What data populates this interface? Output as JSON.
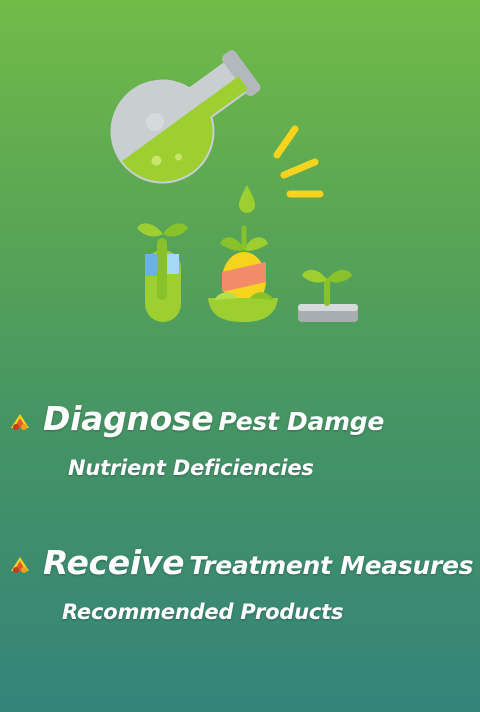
{
  "hero": {
    "illustration": "flask-pouring-onto-plants-illustration",
    "colors": {
      "flask_glass": "#c9ced1",
      "liquid": "#9ccf2f",
      "drop": "#9ccf2f",
      "sparkle": "#f6d41e",
      "leaf": "#9ccf2f",
      "pot_gray": "#a8adb1"
    }
  },
  "features": [
    {
      "icon": "pest-bug-bullet-icon",
      "headline_strong": "Diagnose",
      "headline_rest": "Pest Damge",
      "subline": "Nutrient Deficiencies"
    },
    {
      "icon": "pest-bug-bullet-icon",
      "headline_strong": "Receive",
      "headline_rest": "Treatment Measures",
      "subline": "Recommended Products"
    }
  ],
  "colors": {
    "background_top": "#72bb48",
    "background_bottom": "#34847a",
    "text": "#ffffff"
  }
}
